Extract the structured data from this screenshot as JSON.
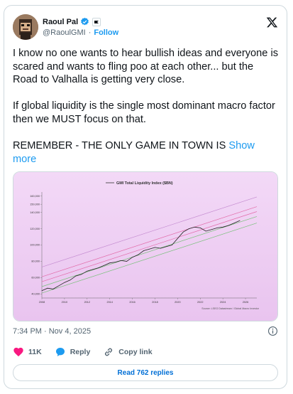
{
  "author": {
    "name": "Raoul Pal",
    "handle": "@RaoulGMI",
    "follow_label": "Follow"
  },
  "tweet": {
    "text": "I know no one wants to hear bullish ideas and everyone is scared and wants to fling poo at each other... but the Road to Valhalla is getting very close.\n\nIf global liquidity is the single most dominant macro factor then we MUST focus on that.\n\nREMEMBER - THE ONLY GAME IN TOWN IS ",
    "show_more_label": "Show more",
    "timestamp": "7:34 PM · Nov 4, 2025"
  },
  "actions": {
    "likes": "11K",
    "reply_label": "Reply",
    "copy_label": "Copy link",
    "read_replies_label": "Read 762 replies"
  },
  "colors": {
    "accent": "#1d9bf0",
    "like": "#f91880",
    "chart_bg_top": "#f3d9f7",
    "chart_bg_bottom": "#e9c4ef"
  },
  "chart_data": {
    "type": "line",
    "title": "GMI Total Liquidity Index ($BN)",
    "legend": "GMI Total Liquidity Index ($BN)",
    "source": "Source: LSEG Datastream / Global Macro Investor",
    "x_ticks": [
      "2008",
      "2010",
      "2012",
      "2014",
      "2016",
      "2018",
      "2020",
      "2022",
      "2024",
      "2026"
    ],
    "y_ticks": [
      "40,000",
      "60,000",
      "80,000",
      "100,000",
      "120,000",
      "140,000",
      "150,000",
      "160,000"
    ],
    "xlim": [
      2008,
      2027
    ],
    "ylim": [
      35000,
      165000
    ],
    "series": [
      {
        "name": "GMI Total Liquidity Index ($BN)",
        "x": [
          2008,
          2008.5,
          2009,
          2009.5,
          2010,
          2010.5,
          2011,
          2011.5,
          2012,
          2012.5,
          2013,
          2013.5,
          2014,
          2014.5,
          2015,
          2015.5,
          2016,
          2016.5,
          2017,
          2017.5,
          2018,
          2018.5,
          2019,
          2019.5,
          2020,
          2020.5,
          2021,
          2021.5,
          2022,
          2022.5,
          2023,
          2023.5,
          2024,
          2024.5,
          2025,
          2025.5
        ],
        "y": [
          44000,
          47000,
          46000,
          50000,
          54000,
          57000,
          62000,
          64000,
          68000,
          70000,
          72000,
          75000,
          78000,
          79000,
          81000,
          80000,
          85000,
          88000,
          93000,
          95000,
          97000,
          96000,
          98000,
          100000,
          108000,
          116000,
          120000,
          122000,
          121000,
          117000,
          119000,
          121000,
          122000,
          124000,
          127000,
          130000
        ]
      }
    ],
    "trend_bands": [
      {
        "color": "#c48bd0",
        "x": [
          2008,
          2027
        ],
        "y": [
          73000,
          159000
        ]
      },
      {
        "color": "#e26aa8",
        "x": [
          2008,
          2027
        ],
        "y": [
          61000,
          147000
        ]
      },
      {
        "color": "#e26aa8",
        "x": [
          2008,
          2027
        ],
        "y": [
          55000,
          141000
        ]
      },
      {
        "color": "#78c07a",
        "x": [
          2008,
          2027
        ],
        "y": [
          49000,
          135000
        ]
      },
      {
        "color": "#78c07a",
        "x": [
          2008,
          2027
        ],
        "y": [
          41000,
          127000
        ]
      }
    ]
  }
}
